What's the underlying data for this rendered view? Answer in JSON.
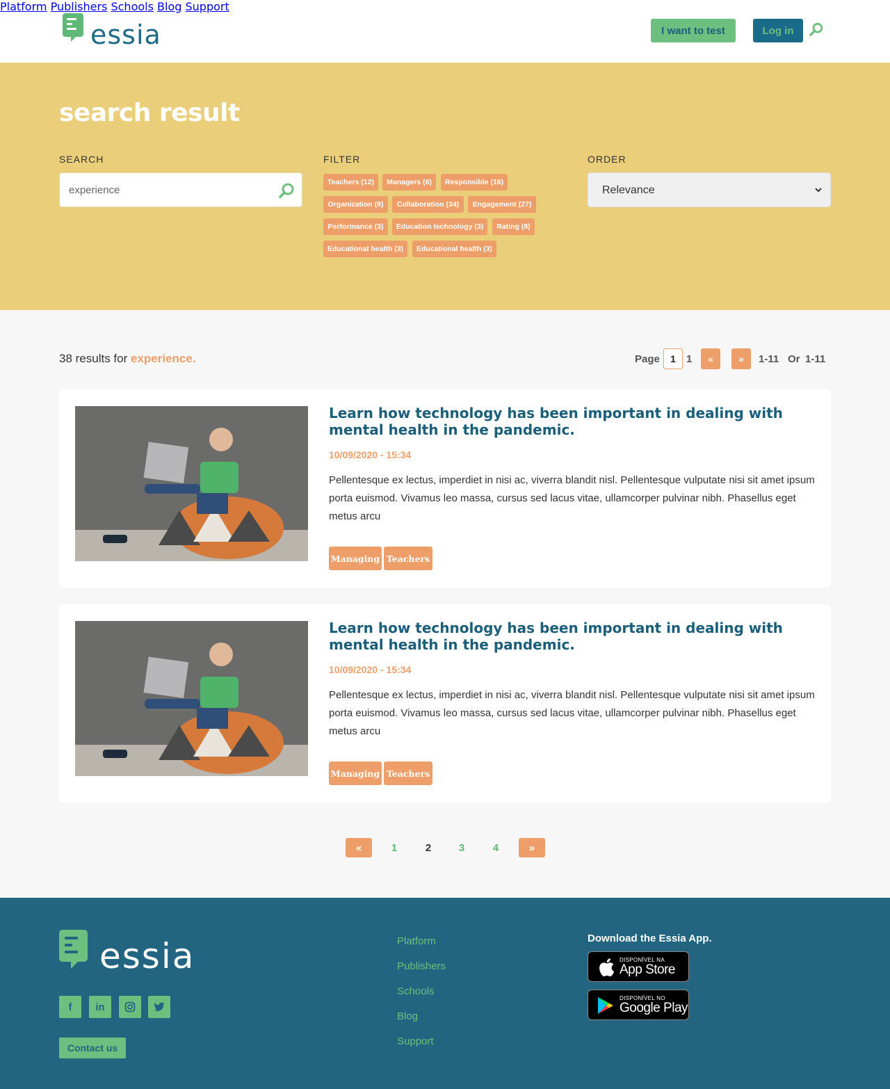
{
  "header": {
    "logo_text": "essia",
    "nav": [
      "Platform",
      "Publishers",
      "Schools",
      "Blog",
      "Support"
    ],
    "test_button": "I want to test",
    "login_button": "Log in"
  },
  "hero": {
    "title": "search result",
    "search_label": "SEARCH",
    "search_value": "experience",
    "filter_label": "FILTER",
    "filters": [
      "Teachers (12)",
      "Managers (6)",
      "Responsible (16)",
      "Organization (8)",
      "Collaboration (34)",
      "Engagement (27)",
      "Performance (3)",
      "Education technology (3)",
      "Rating (8)",
      "Educational health (3)",
      "Educational health (3)"
    ],
    "order_label": "ORDER",
    "order_value": "Relevance"
  },
  "results": {
    "count_text": "38 results for ",
    "query": "experience.",
    "pager": {
      "page_label": "Page",
      "current": "1",
      "total": "1",
      "prev": "«",
      "next": "»",
      "range_a": "1-11",
      "or": "Or",
      "range_b": "1-11"
    }
  },
  "articles": [
    {
      "title": "Learn how technology has been important in dealing with mental health in the pandemic.",
      "date": "10/09/2020 - 15:34",
      "excerpt": "Pellentesque ex lectus, imperdiet in nisi ac, viverra blandit nisl. Pellentesque vulputate nisi sit amet ipsum porta euismod. Vivamus leo massa, cursus sed lacus vitae, ullamcorper pulvinar nibh. Phasellus eget metus arcu",
      "tags": [
        "Managing",
        "Teachers"
      ]
    },
    {
      "title": "Learn how technology has been important in dealing with mental health in the pandemic.",
      "date": "10/09/2020 - 15:34",
      "excerpt": "Pellentesque ex lectus, imperdiet in nisi ac, viverra blandit nisl. Pellentesque vulputate nisi sit amet ipsum porta euismod. Vivamus leo massa, cursus sed lacus vitae, ullamcorper pulvinar nibh. Phasellus eget metus arcu",
      "tags": [
        "Managing",
        "Teachers"
      ]
    }
  ],
  "pagination": {
    "prev": "«",
    "pages": [
      "1",
      "2",
      "3",
      "4"
    ],
    "current": "2",
    "next": "»"
  },
  "footer": {
    "logo_text": "essia",
    "social_icons": [
      "facebook-icon",
      "linkedin-icon",
      "instagram-icon",
      "twitter-icon"
    ],
    "contact_button": "Contact us",
    "links": [
      "Platform",
      "Publishers",
      "Schools",
      "Blog",
      "Support"
    ],
    "download_title": "Download the Essia App.",
    "app_store": {
      "small": "DISPONÍVEL NA",
      "big": "App Store"
    },
    "google_play": {
      "small": "DISPONÍVEL NO",
      "big": "Google Play"
    }
  },
  "colors": {
    "brand_green": "#6cbf7f",
    "brand_blue": "#1a5e7a",
    "hero_yellow": "#ebce7a",
    "accent_orange": "#ee9e68",
    "footer_blue": "#236580"
  }
}
